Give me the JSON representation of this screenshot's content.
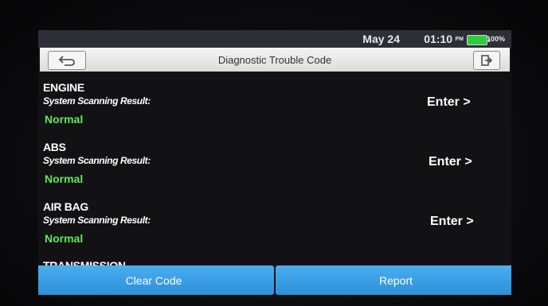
{
  "status": {
    "date": "May 24",
    "time": "01:10",
    "ampm": "PM",
    "battery": "100%"
  },
  "header": {
    "title": "Diagnostic Trouble Code",
    "back_icon": "back-arrow-icon",
    "exit_icon": "exit-icon"
  },
  "systems": [
    {
      "name": "ENGINE",
      "label": "System Scanning Result:",
      "status": "Normal",
      "action": "Enter >"
    },
    {
      "name": "ABS",
      "label": "System Scanning Result:",
      "status": "Normal",
      "action": "Enter >"
    },
    {
      "name": "AIR BAG",
      "label": "System Scanning Result:",
      "status": "Normal",
      "action": "Enter >"
    },
    {
      "name": "TRANSMISSION",
      "label": "",
      "status": "",
      "action": ""
    }
  ],
  "footer": {
    "clear_label": "Clear Code",
    "report_label": "Report"
  },
  "colors": {
    "status_normal": "#5fe85a",
    "button_blue": "#3aa0e6",
    "battery_green": "#2ecc40"
  }
}
